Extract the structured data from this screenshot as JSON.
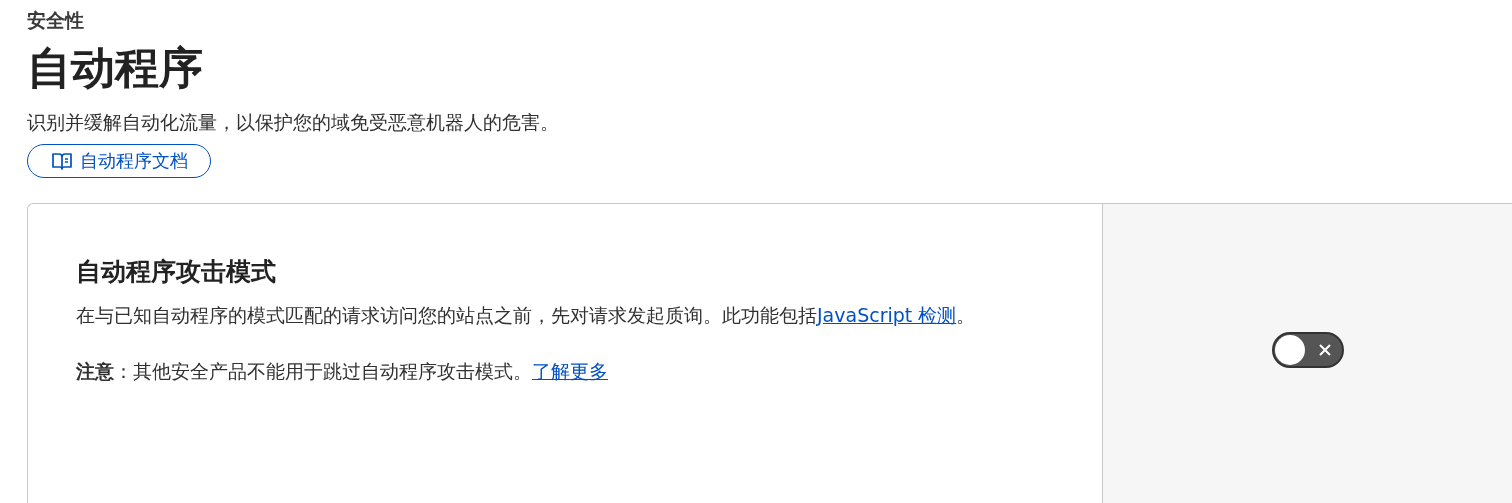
{
  "breadcrumb": "安全性",
  "title": "自动程序",
  "description": "识别并缓解自动化流量，以保护您的域免受恶意机器人的危害。",
  "docs_button": {
    "label": "自动程序文档"
  },
  "setting": {
    "title": "自动程序攻击模式",
    "description": "在与已知自动程序的模式匹配的请求访问您的站点之前，先对请求发起质询。此功能包括",
    "description_link": "JavaScript 检测",
    "description_end": "。",
    "note": "**注意**：其他安全产品不能用于跳过自动程序攻击模式。",
    "note_link": "了解更多",
    "toggle": {
      "on": false
    }
  }
}
